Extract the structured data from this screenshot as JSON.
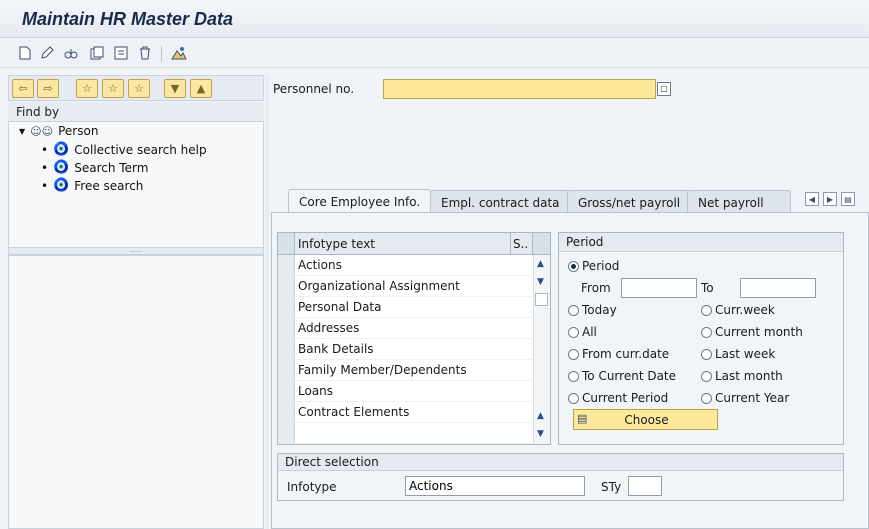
{
  "window": {
    "title": "Maintain HR Master Data"
  },
  "toolbar": {
    "icons": [
      "create-icon",
      "change-icon",
      "display-icon",
      "copy-icon",
      "delimit-icon",
      "delete-icon",
      "overview-icon"
    ]
  },
  "nav": {
    "find_by_label": "Find by",
    "tree": {
      "root": "Person",
      "children": [
        "Collective search help",
        "Search Term",
        "Free search"
      ]
    }
  },
  "personnel": {
    "label": "Personnel no.",
    "value": ""
  },
  "tabs": [
    {
      "label": "Core Employee Info.",
      "active": true
    },
    {
      "label": "Empl. contract data",
      "active": false
    },
    {
      "label": "Gross/net payroll",
      "active": false
    },
    {
      "label": "Net payroll",
      "active": false
    }
  ],
  "infotype_table": {
    "columns": [
      "Infotype text",
      "S.."
    ],
    "rows": [
      "Actions",
      "Organizational Assignment",
      "Personal Data",
      "Addresses",
      "Bank Details",
      "Family Member/Dependents",
      "Loans",
      "Contract Elements",
      ""
    ]
  },
  "period": {
    "title": "Period",
    "period_option": "Period",
    "from_label": "From",
    "to_label": "To",
    "from_value": "",
    "to_value": "",
    "left_options": [
      "Today",
      "All",
      "From curr.date",
      "To Current Date",
      "Current Period"
    ],
    "right_options": [
      "Curr.week",
      "Current month",
      "Last week",
      "Last month",
      "Current Year"
    ],
    "selected": "Period",
    "choose_label": "Choose"
  },
  "direct_selection": {
    "title": "Direct selection",
    "infotype_label": "Infotype",
    "infotype_value": "Actions",
    "sty_label": "STy",
    "sty_value": ""
  },
  "colors": {
    "input_highlight": "#fde99b",
    "accent": "#1b2a4a"
  }
}
